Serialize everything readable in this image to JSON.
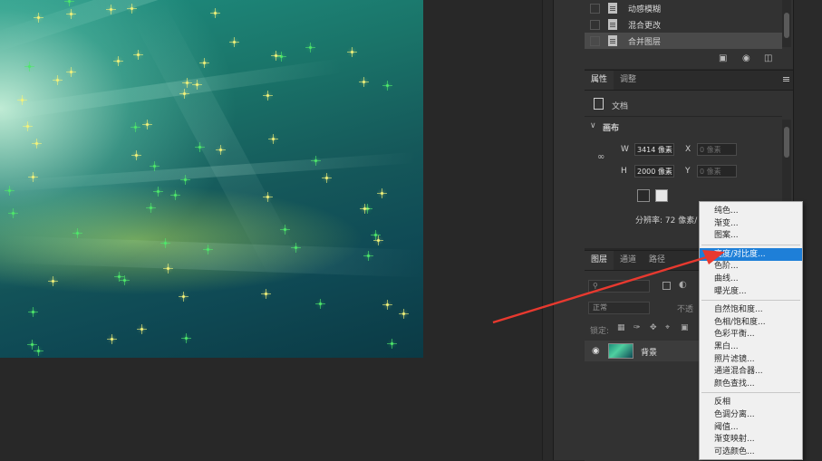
{
  "history": {
    "items": [
      {
        "label": "动感模糊",
        "selected": false
      },
      {
        "label": "混合更改",
        "selected": false
      },
      {
        "label": "合并图层",
        "selected": true
      }
    ]
  },
  "properties": {
    "tabs": [
      "属性",
      "调整"
    ],
    "doc_label": "文档",
    "section_title": "画布",
    "width_label": "W",
    "width_value": "3414 像素",
    "height_label": "H",
    "height_value": "2000 像素",
    "x_label": "X",
    "x_placeholder": "0 像素",
    "y_label": "Y",
    "y_placeholder": "0 像素",
    "resolution_text": "分辨率: 72 像素/"
  },
  "layers": {
    "tabs": [
      "图层",
      "通道",
      "路径"
    ],
    "blend_mode": "正常",
    "opacity_label": "不透",
    "lock_label": "锁定:",
    "layer_name": "背景"
  },
  "adjustment_menu": {
    "highlighted_index": 3,
    "groups": [
      [
        "纯色...",
        "渐变...",
        "图案..."
      ],
      [
        "亮度/对比度...",
        "色阶...",
        "曲线...",
        "曝光度..."
      ],
      [
        "自然饱和度...",
        "色相/饱和度...",
        "色彩平衡...",
        "黑白...",
        "照片滤镜...",
        "通道混合器...",
        "颜色查找..."
      ],
      [
        "反相",
        "色调分离...",
        "阈值...",
        "渐变映射...",
        "可选颜色..."
      ]
    ]
  },
  "colors": {
    "accent_highlight": "#1e7fd8",
    "annotation_arrow": "#e8392f",
    "panel_bg": "#323232"
  },
  "icons": [
    "document-icon",
    "chain-link-icon",
    "portrait-orientation-icon",
    "landscape-orientation-icon",
    "new-snapshot-icon",
    "camera-icon",
    "trash-icon",
    "visibility-eye-icon",
    "panel-menu-icon"
  ]
}
